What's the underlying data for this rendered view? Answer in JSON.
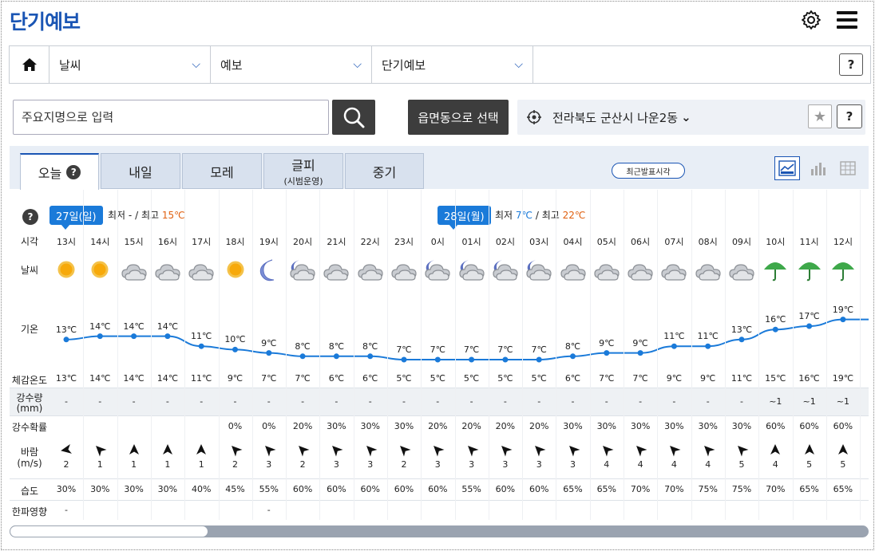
{
  "header": {
    "title": "단기예보"
  },
  "nav": {
    "items": [
      {
        "label": "날씨"
      },
      {
        "label": "예보"
      },
      {
        "label": "단기예보"
      }
    ],
    "help_label": "?"
  },
  "search": {
    "placeholder": "주요지명으로 입력",
    "select_label": "읍면동으로 선택",
    "location": "전라북도 군산시 나운2동",
    "location_chevron": "⌄",
    "help_label": "?"
  },
  "tabs": [
    {
      "label": "오늘",
      "sub": "",
      "active": true
    },
    {
      "label": "내일",
      "sub": ""
    },
    {
      "label": "모레",
      "sub": ""
    },
    {
      "label": "글피",
      "sub": "(시범운영)"
    },
    {
      "label": "중기",
      "sub": ""
    }
  ],
  "latest_label": "최근발표시각",
  "colors": {
    "accent": "#1a55b4",
    "badge": "#1a7ad9",
    "low": "#1a7ad9",
    "high": "#e06010",
    "line": "#1a7ad9"
  },
  "days": [
    {
      "badge": "27일(일)",
      "low_label": "최저",
      "low": "-",
      "high_label": "최고",
      "high": "15℃"
    },
    {
      "badge": "28일(월)",
      "low_label": "최저",
      "low": "7℃",
      "high_label": "최고",
      "high": "22℃"
    }
  ],
  "row_labels": {
    "time": "시각",
    "weather": "날씨",
    "temp": "기온",
    "feel": "체감온도",
    "rain": "강수량",
    "rain_unit": "(mm)",
    "prob": "강수확률",
    "wind": "바람",
    "wind_unit": "(m/s)",
    "humid": "습도",
    "cold": "한파영향"
  },
  "hours": [
    {
      "t": "13시",
      "w": "sun",
      "temp": 13,
      "feel": "13℃",
      "rain": "-",
      "prob": "",
      "wdir": 260,
      "wspd": "2",
      "hum": "30%",
      "cold": "-"
    },
    {
      "t": "14시",
      "w": "sun",
      "temp": 14,
      "feel": "14℃",
      "rain": "-",
      "prob": "",
      "wdir": 315,
      "wspd": "1",
      "hum": "30%",
      "cold": ""
    },
    {
      "t": "15시",
      "w": "cloud",
      "temp": 14,
      "feel": "14℃",
      "rain": "-",
      "prob": "",
      "wdir": 0,
      "wspd": "1",
      "hum": "30%",
      "cold": ""
    },
    {
      "t": "16시",
      "w": "cloud",
      "temp": 14,
      "feel": "14℃",
      "rain": "-",
      "prob": "",
      "wdir": 0,
      "wspd": "1",
      "hum": "30%",
      "cold": ""
    },
    {
      "t": "17시",
      "w": "cloud",
      "temp": 11,
      "feel": "11℃",
      "rain": "-",
      "prob": "",
      "wdir": 0,
      "wspd": "1",
      "hum": "40%",
      "cold": ""
    },
    {
      "t": "18시",
      "w": "sun",
      "temp": 10,
      "feel": "9℃",
      "rain": "-",
      "prob": "0%",
      "wdir": 315,
      "wspd": "2",
      "hum": "45%",
      "cold": ""
    },
    {
      "t": "19시",
      "w": "moon",
      "temp": 9,
      "feel": "7℃",
      "rain": "-",
      "prob": "0%",
      "wdir": 315,
      "wspd": "3",
      "hum": "55%",
      "cold": "-"
    },
    {
      "t": "20시",
      "w": "mooncloud",
      "temp": 8,
      "feel": "7℃",
      "rain": "-",
      "prob": "20%",
      "wdir": 315,
      "wspd": "2",
      "hum": "60%",
      "cold": ""
    },
    {
      "t": "21시",
      "w": "cloud",
      "temp": 8,
      "feel": "6℃",
      "rain": "-",
      "prob": "30%",
      "wdir": 315,
      "wspd": "3",
      "hum": "60%",
      "cold": ""
    },
    {
      "t": "22시",
      "w": "cloud",
      "temp": 8,
      "feel": "6℃",
      "rain": "-",
      "prob": "30%",
      "wdir": 315,
      "wspd": "3",
      "hum": "60%",
      "cold": ""
    },
    {
      "t": "23시",
      "w": "cloud",
      "temp": 7,
      "feel": "5℃",
      "rain": "-",
      "prob": "30%",
      "wdir": 315,
      "wspd": "2",
      "hum": "60%",
      "cold": ""
    },
    {
      "t": "0시",
      "w": "mooncloud",
      "temp": 7,
      "feel": "5℃",
      "rain": "-",
      "prob": "20%",
      "wdir": 315,
      "wspd": "3",
      "hum": "60%",
      "cold": ""
    },
    {
      "t": "01시",
      "w": "mooncloud",
      "temp": 7,
      "feel": "5℃",
      "rain": "-",
      "prob": "20%",
      "wdir": 315,
      "wspd": "3",
      "hum": "55%",
      "cold": ""
    },
    {
      "t": "02시",
      "w": "mooncloud",
      "temp": 7,
      "feel": "5℃",
      "rain": "-",
      "prob": "20%",
      "wdir": 315,
      "wspd": "3",
      "hum": "60%",
      "cold": ""
    },
    {
      "t": "03시",
      "w": "mooncloud",
      "temp": 7,
      "feel": "5℃",
      "rain": "-",
      "prob": "20%",
      "wdir": 315,
      "wspd": "3",
      "hum": "60%",
      "cold": ""
    },
    {
      "t": "04시",
      "w": "cloud",
      "temp": 8,
      "feel": "6℃",
      "rain": "-",
      "prob": "30%",
      "wdir": 315,
      "wspd": "3",
      "hum": "65%",
      "cold": ""
    },
    {
      "t": "05시",
      "w": "cloud",
      "temp": 9,
      "feel": "7℃",
      "rain": "-",
      "prob": "30%",
      "wdir": 315,
      "wspd": "4",
      "hum": "65%",
      "cold": ""
    },
    {
      "t": "06시",
      "w": "cloud",
      "temp": 9,
      "feel": "7℃",
      "rain": "-",
      "prob": "30%",
      "wdir": 315,
      "wspd": "4",
      "hum": "70%",
      "cold": ""
    },
    {
      "t": "07시",
      "w": "cloud",
      "temp": 11,
      "feel": "9℃",
      "rain": "-",
      "prob": "30%",
      "wdir": 315,
      "wspd": "4",
      "hum": "70%",
      "cold": ""
    },
    {
      "t": "08시",
      "w": "cloud",
      "temp": 11,
      "feel": "9℃",
      "rain": "-",
      "prob": "30%",
      "wdir": 315,
      "wspd": "4",
      "hum": "75%",
      "cold": ""
    },
    {
      "t": "09시",
      "w": "cloud",
      "temp": 13,
      "feel": "11℃",
      "rain": "-",
      "prob": "30%",
      "wdir": 315,
      "wspd": "5",
      "hum": "75%",
      "cold": ""
    },
    {
      "t": "10시",
      "w": "rain",
      "temp": 16,
      "feel": "15℃",
      "rain": "~1",
      "prob": "60%",
      "wdir": 0,
      "wspd": "4",
      "hum": "70%",
      "cold": ""
    },
    {
      "t": "11시",
      "w": "rain",
      "temp": 17,
      "feel": "16℃",
      "rain": "~1",
      "prob": "60%",
      "wdir": 0,
      "wspd": "5",
      "hum": "65%",
      "cold": ""
    },
    {
      "t": "12시",
      "w": "rain",
      "temp": 19,
      "feel": "19℃",
      "rain": "~1",
      "prob": "60%",
      "wdir": 0,
      "wspd": "5",
      "hum": "65%",
      "cold": ""
    }
  ]
}
